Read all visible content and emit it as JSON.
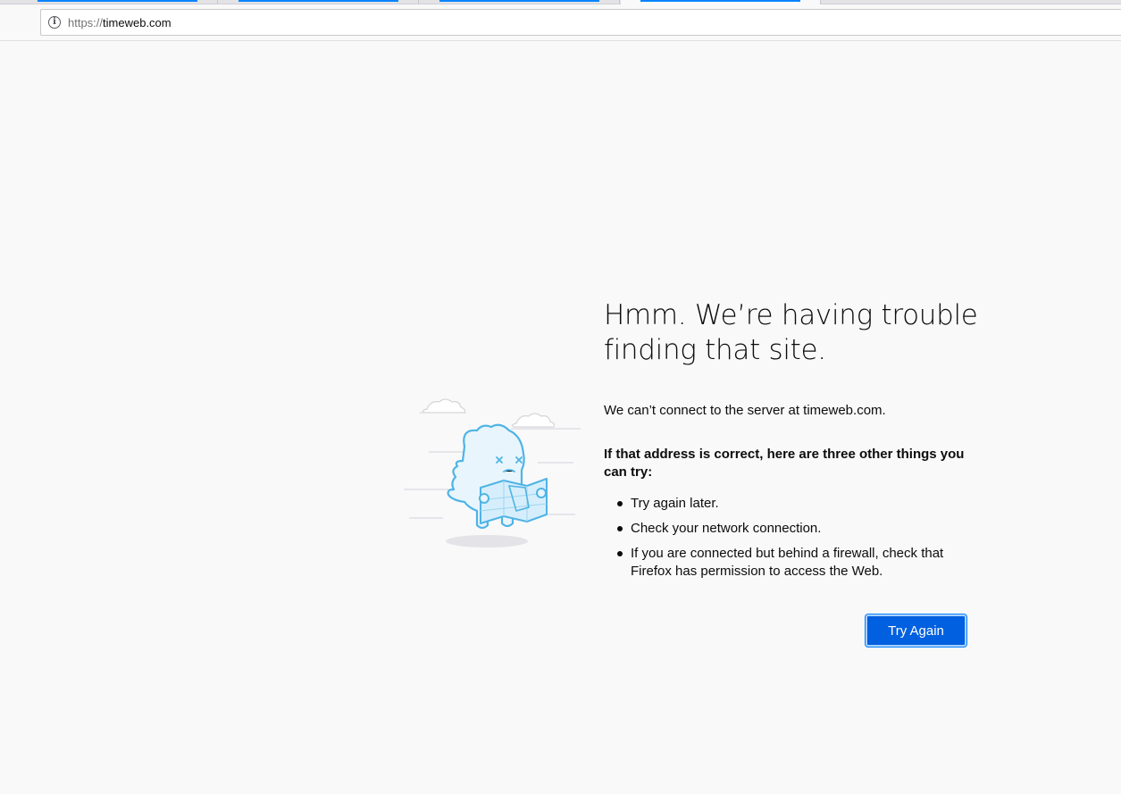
{
  "browser": {
    "url_scheme": "https://",
    "url_host": "timeweb.com",
    "info_icon_symbol": "i"
  },
  "error": {
    "title": "Hmm. We’re having trouble finding that site.",
    "description": "We can’t connect to the server at timeweb.com.",
    "subheading": "If that address is correct, here are three other things you can try:",
    "tips": [
      "Try again later.",
      "Check your network connection.",
      "If you are connected but behind a firewall, check that Firefox has permission to access the Web."
    ],
    "try_again_label": "Try Again"
  },
  "colors": {
    "accent": "#0060df",
    "tab_highlight": "#0a84ff",
    "page_background": "#f9f9fa",
    "illustration_stroke": "#4fb4e5",
    "illustration_fill": "#e8f5fc"
  }
}
